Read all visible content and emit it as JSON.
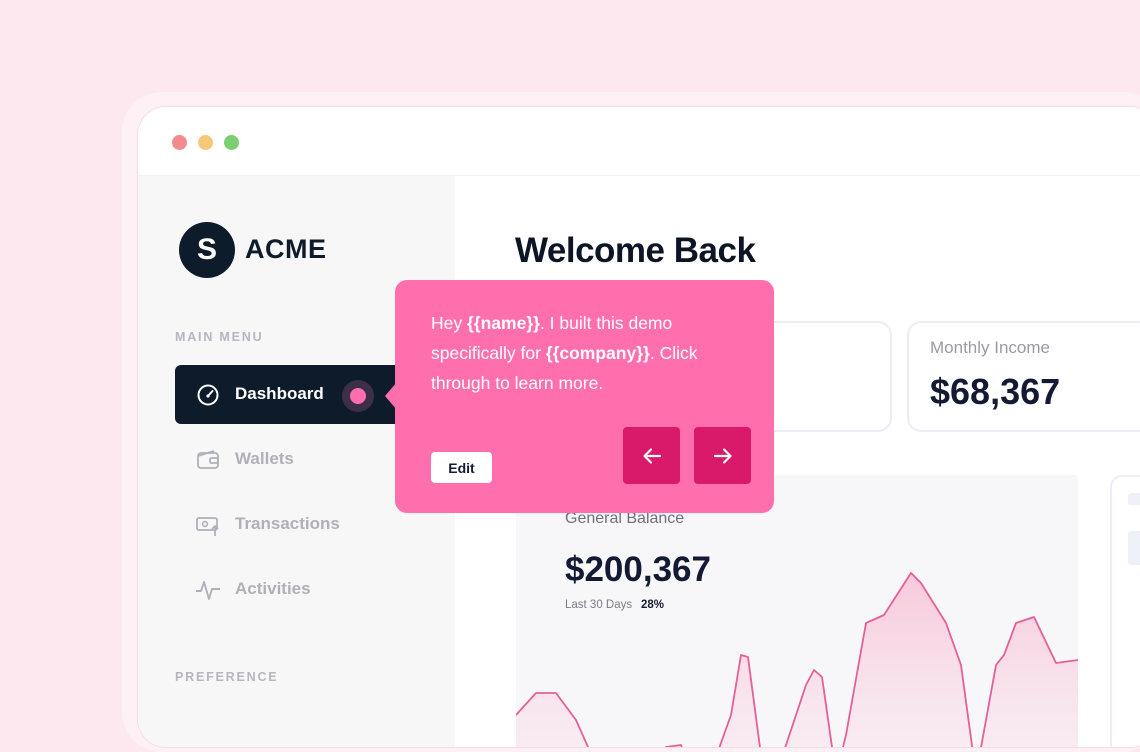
{
  "window": {
    "controls": [
      "close",
      "minimize",
      "maximize"
    ]
  },
  "sidebar": {
    "logo_letter": "S",
    "logo_text": "ACME",
    "main_menu_heading": "MAIN MENU",
    "items": [
      {
        "label": "Dashboard",
        "icon": "gauge-icon",
        "active": true
      },
      {
        "label": "Wallets",
        "icon": "wallet-icon",
        "active": false
      },
      {
        "label": "Transactions",
        "icon": "transactions-icon",
        "active": false
      },
      {
        "label": "Activities",
        "icon": "activity-icon",
        "active": false
      }
    ],
    "preference_heading": "PREFERENCE"
  },
  "main": {
    "title": "Welcome Back",
    "cards": [
      {
        "label": "Monthly Income",
        "value": "$68,367"
      }
    ],
    "balance": {
      "label": "General Balance",
      "value": "$200,367",
      "period": "Last 30 Days",
      "change": "28%"
    }
  },
  "tooltip": {
    "line_intro": "Hey ",
    "name_var": "{{name}}",
    "line_mid": ". I built this demo specifically for ",
    "company_var": "{{company}}",
    "line_end": ". Click through to learn more.",
    "edit_label": "Edit",
    "prev_icon": "arrow-left-icon",
    "next_icon": "arrow-right-icon"
  },
  "colors": {
    "accent": "#ff6fae",
    "accent_dark": "#d9196a",
    "navy": "#0d1b2a",
    "background": "#fde8f0"
  }
}
